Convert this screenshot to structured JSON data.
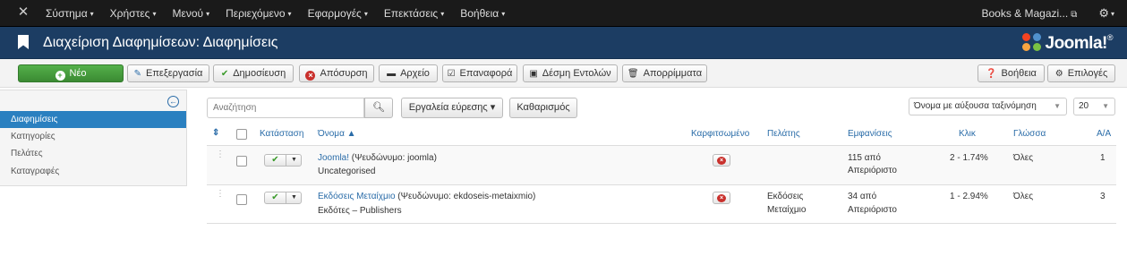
{
  "navbar": {
    "menu": [
      "Σύστημα",
      "Χρήστες",
      "Μενού",
      "Περιεχόμενο",
      "Εφαρμογές",
      "Επεκτάσεις",
      "Βοήθεια"
    ],
    "site_name": "Books & Magazi...",
    "caret": "▾"
  },
  "header": {
    "title": "Διαχείριση Διαφημίσεων: Διαφημίσεις",
    "brand": "Joomla!",
    "brand_sup": "®"
  },
  "toolbar": {
    "new": "Νέο",
    "edit": "Επεξεργασία",
    "publish": "Δημοσίευση",
    "unpublish": "Απόσυρση",
    "archive": "Αρχείο",
    "checkin": "Επαναφορά",
    "batch": "Δέσμη Εντολών",
    "trash": "Απορρίμματα",
    "help": "Βοήθεια",
    "options": "Επιλογές"
  },
  "sidebar": {
    "items": [
      "Διαφημίσεις",
      "Κατηγορίες",
      "Πελάτες",
      "Καταγραφές"
    ],
    "active_index": 0
  },
  "filters": {
    "search_placeholder": "Αναζήτηση",
    "search_tools": "Εργαλεία εύρεσης ▾",
    "clear": "Καθαρισμός",
    "ordering": "Όνομα με αύξουσα ταξινόμηση",
    "limit": "20"
  },
  "table": {
    "columns": {
      "status": "Κατάσταση",
      "name": "Όνομα ▲",
      "pinned": "Καρφιτσωμένο",
      "client": "Πελάτης",
      "impressions": "Εμφανίσεις",
      "clicks": "Κλικ",
      "language": "Γλώσσα",
      "id": "Α/Α"
    },
    "rows": [
      {
        "name": "Joomla!",
        "alias": " (Ψευδώνυμο: joomla)",
        "category": "Uncategorised",
        "client_line1": "",
        "client_line2": "",
        "impressions_line1": "115 από",
        "impressions_line2": "Απεριόριστο",
        "clicks": "2 - 1.74%",
        "language": "Όλες",
        "id": "1"
      },
      {
        "name": "Εκδόσεις Μεταίχμιο",
        "alias": " (Ψευδώνυμο: ekdoseis-metaixmio)",
        "category": "Εκδότες – Publishers",
        "client_line1": "Εκδόσεις",
        "client_line2": "Μεταίχμιο",
        "impressions_line1": "34 από",
        "impressions_line2": "Απεριόριστο",
        "clicks": "1 - 2.94%",
        "language": "Όλες",
        "id": "3"
      }
    ]
  },
  "colors": {
    "navbar": "#1a1a1a",
    "header": "#1c3d63",
    "accent": "#2a80c0",
    "new_button": "#46a13c",
    "unpublished": "#c9302c"
  }
}
